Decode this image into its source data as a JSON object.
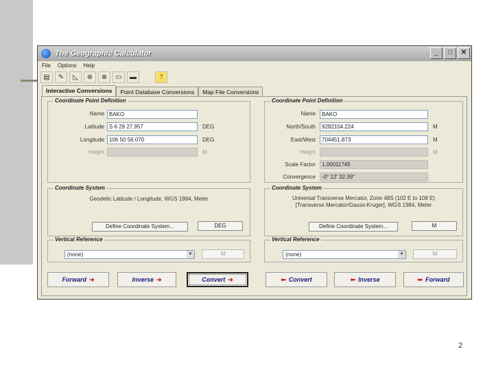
{
  "window": {
    "title": "The Geographic Calculator"
  },
  "menu": [
    "File",
    "Options",
    "Help"
  ],
  "toolbar": [
    "open-icon",
    "pencil-icon",
    "triangle-ruler-icon",
    "globe-icon",
    "globe-grid-icon",
    "monitor-icon",
    "folder-icon",
    "help-icon"
  ],
  "toolbar_glyphs": [
    "▤",
    "✎",
    "◺",
    "⊕",
    "⊗",
    "▭",
    "▬",
    "?"
  ],
  "tabs": [
    "Interactive Conversions",
    "Point Database Conversions",
    "Map File Conversions"
  ],
  "left": {
    "point_group": "Coordinate Point Definition",
    "labels": {
      "name": "Name",
      "latitude": "Latitude",
      "longitude": "Longitude",
      "height": "Height"
    },
    "values": {
      "name": "BAKO",
      "latitude": "S 6 29 27.957",
      "longitude": "106 50 56.070",
      "height": ""
    },
    "units": {
      "latitude": "DEG",
      "longitude": "DEG",
      "height": "M"
    },
    "system_group": "Coordinate System",
    "system_text": "Geodetic Latitude / Longitude, WGS 1984, Meter",
    "define_button": "Define Coordinate System...",
    "unit_button": "DEG",
    "vertical_group": "Vertical Reference",
    "vertical_value": "(none)",
    "vertical_unit": "M"
  },
  "right": {
    "point_group": "Coordinate Point Definition",
    "labels": {
      "name": "Name",
      "north": "North/South",
      "east": "East/West",
      "height": "Height",
      "scale": "Scale Factor",
      "convergence": "Convergence"
    },
    "values": {
      "name": "BAKO",
      "north": "9282104.224",
      "east": "704451.873",
      "height": "",
      "scale": "1.00011745",
      "convergence": "-0° 12' 32.39\""
    },
    "units": {
      "north": "M",
      "east": "M",
      "height": "M"
    },
    "system_group": "Coordinate System",
    "system_text_1": "Universal Transverse Mercator, Zone 48S (102 E to 108 E)",
    "system_text_2": "[Transverse Mercator/Gauss-Kruger], WGS 1984, Meter",
    "define_button": "Define Coordinate System...",
    "unit_button": "M",
    "vertical_group": "Vertical Reference",
    "vertical_value": "(none)",
    "vertical_unit": "M"
  },
  "actions": {
    "left_forward": "Forward",
    "left_inverse": "Inverse",
    "left_convert": "Convert",
    "right_convert": "Convert",
    "right_inverse": "Inverse",
    "right_forward": "Forward",
    "arrow_right": "➜",
    "arrow_left": "⬅"
  },
  "slide_number": "2"
}
